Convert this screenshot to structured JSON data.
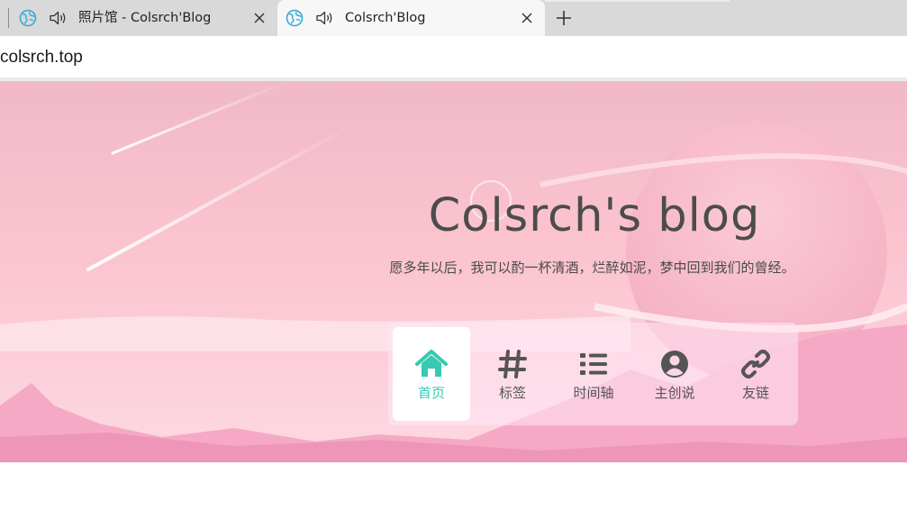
{
  "browser": {
    "tabs": [
      {
        "title": "照片馆 - Colsrch'Blog",
        "active": false,
        "audio": true
      },
      {
        "title": "Colsrch'Blog",
        "active": true,
        "audio": true
      }
    ],
    "new_tab_icon": "plus-icon",
    "close_icon": "close-icon",
    "favicon": "globe-favicon-icon",
    "audio_icon": "speaker-icon",
    "address": "colsrch.top",
    "accent_color": "#2bb3a3"
  },
  "hero": {
    "title": "Colsrch's blog",
    "subtitle": "愿多年以后，我可以酌一杯清酒，烂醉如泥，梦中回到我们的曾经。",
    "nav": [
      {
        "label": "首页",
        "icon": "home-icon",
        "active": true
      },
      {
        "label": "标签",
        "icon": "hashtag-icon",
        "active": false
      },
      {
        "label": "时间轴",
        "icon": "list-icon",
        "active": false
      },
      {
        "label": "主创说",
        "icon": "user-circle-icon",
        "active": false
      },
      {
        "label": "友链",
        "icon": "link-icon",
        "active": false
      }
    ],
    "active_color": "#37c9b2",
    "text_color": "#555555"
  }
}
